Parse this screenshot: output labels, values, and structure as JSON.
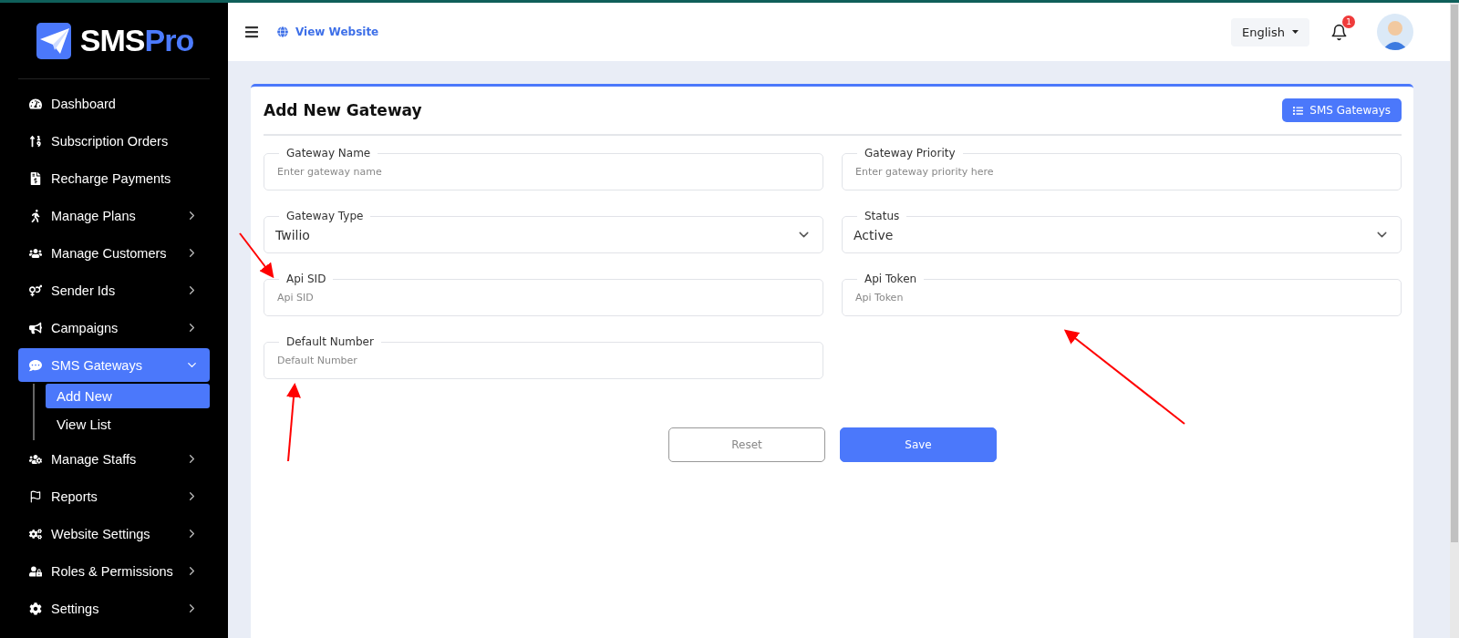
{
  "brand": {
    "first": "SMS",
    "second": "Pro"
  },
  "sidebar": {
    "items": [
      {
        "label": "Dashboard",
        "kind": "link",
        "selected": false
      },
      {
        "label": "Subscription Orders",
        "kind": "link",
        "selected": false
      },
      {
        "label": "Recharge Payments",
        "kind": "link",
        "selected": false
      },
      {
        "label": "Manage Plans",
        "kind": "group",
        "expanded": false,
        "selected": false
      },
      {
        "label": "Manage Customers",
        "kind": "group",
        "expanded": false,
        "selected": false
      },
      {
        "label": "Sender Ids",
        "kind": "group",
        "expanded": false,
        "selected": false
      },
      {
        "label": "Campaigns",
        "kind": "group",
        "expanded": false,
        "selected": false
      },
      {
        "label": "SMS Gateways",
        "kind": "group",
        "expanded": true,
        "selected": true,
        "children": [
          {
            "label": "Add New",
            "selected": true
          },
          {
            "label": "View List",
            "selected": false
          }
        ]
      },
      {
        "label": "Manage Staffs",
        "kind": "group",
        "expanded": false,
        "selected": false
      },
      {
        "label": "Reports",
        "kind": "group",
        "expanded": false,
        "selected": false
      },
      {
        "label": "Website Settings",
        "kind": "group",
        "expanded": false,
        "selected": false
      },
      {
        "label": "Roles & Permissions",
        "kind": "group",
        "expanded": false,
        "selected": false
      },
      {
        "label": "Settings",
        "kind": "group",
        "expanded": false,
        "selected": false
      }
    ]
  },
  "header": {
    "view_website": "View Website",
    "language": "English",
    "notification_count": "1"
  },
  "card": {
    "title": "Add New Gateway",
    "list_button": "SMS Gateways",
    "fields": [
      {
        "kind": "input",
        "label": "Gateway Name",
        "placeholder": "Enter gateway name"
      },
      {
        "kind": "input",
        "label": "Gateway Priority",
        "placeholder": "Enter gateway priority here"
      },
      {
        "kind": "select",
        "label": "Gateway Type",
        "value": "Twilio"
      },
      {
        "kind": "select",
        "label": "Status",
        "value": "Active"
      },
      {
        "kind": "input",
        "label": "Api SID",
        "placeholder": "Api SID"
      },
      {
        "kind": "input",
        "label": "Api Token",
        "placeholder": "Api Token"
      },
      {
        "kind": "input",
        "label": "Default Number",
        "placeholder": "Default Number"
      }
    ],
    "buttons": [
      {
        "label": "Reset",
        "kind": "outline"
      },
      {
        "label": "Save",
        "kind": "primary"
      }
    ]
  }
}
